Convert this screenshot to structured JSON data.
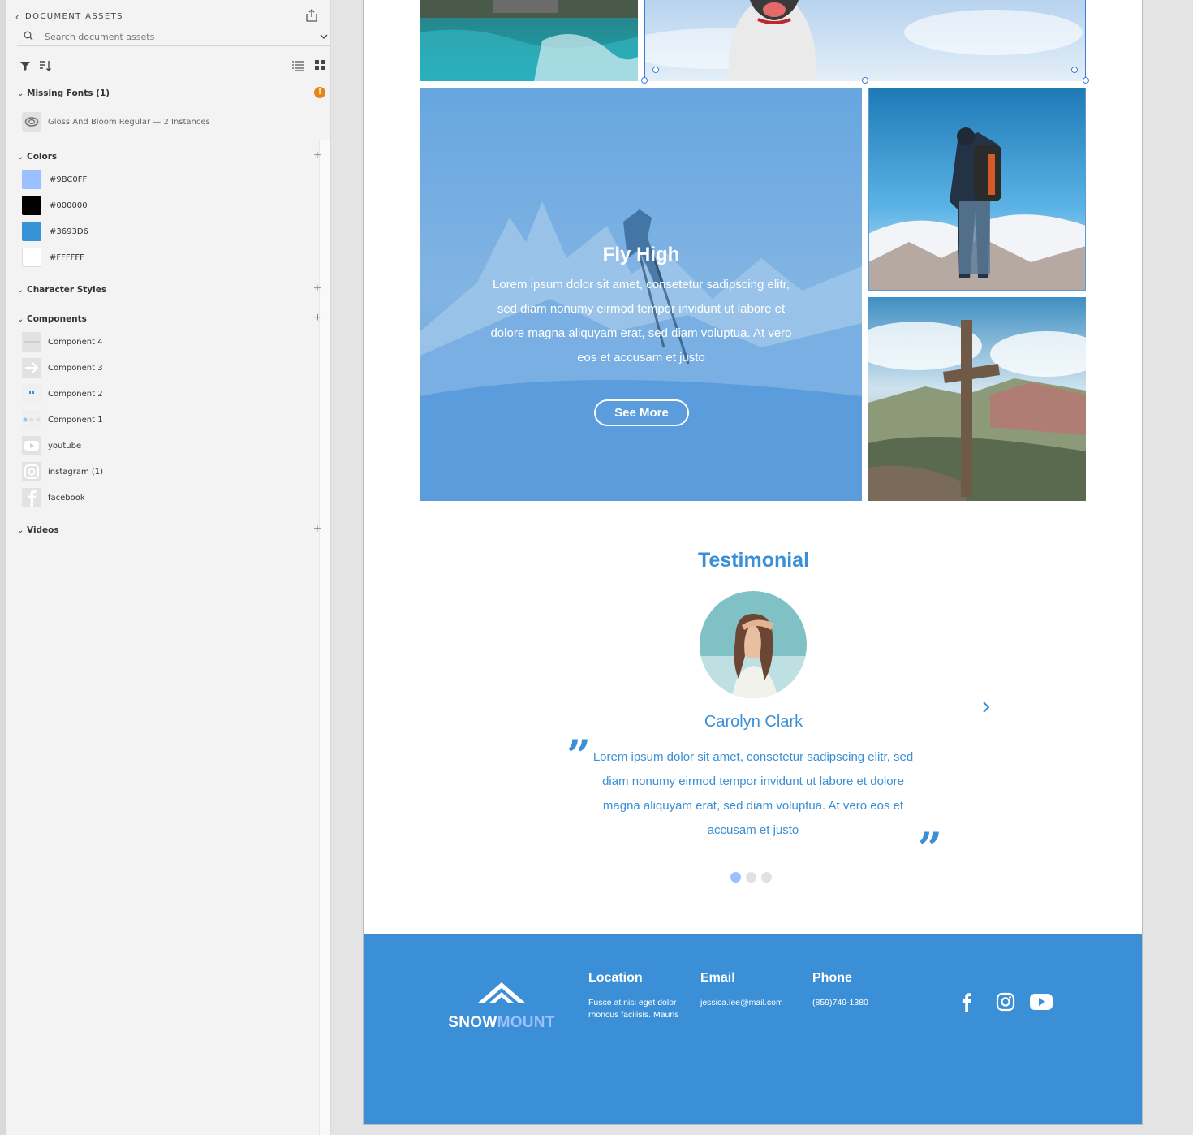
{
  "sidebar": {
    "title": "DOCUMENT ASSETS",
    "search_placeholder": "Search document assets",
    "missing_fonts": {
      "label": "Missing Fonts (1)",
      "items": [
        {
          "label": "Gloss And Bloom Regular — 2 Instances"
        }
      ]
    },
    "colors": {
      "label": "Colors",
      "items": [
        {
          "label": "#9BC0FF",
          "hex": "#9BC0FF"
        },
        {
          "label": "#000000",
          "hex": "#000000"
        },
        {
          "label": "#3693D6",
          "hex": "#3693D6"
        },
        {
          "label": "#FFFFFF",
          "hex": "#FFFFFF"
        }
      ]
    },
    "character_styles": {
      "label": "Character Styles"
    },
    "components": {
      "label": "Components",
      "items": [
        {
          "label": "Component 4"
        },
        {
          "label": "Component 3"
        },
        {
          "label": "Component 2"
        },
        {
          "label": "Component 1"
        },
        {
          "label": "youtube"
        },
        {
          "label": "instagram (1)"
        },
        {
          "label": "facebook"
        }
      ]
    },
    "videos": {
      "label": "Videos"
    }
  },
  "artboard": {
    "hero": {
      "title": "Fly High",
      "body": "Lorem ipsum dolor sit amet, consetetur sadipscing elitr, sed diam nonumy eirmod tempor invidunt ut labore et dolore magna aliquyam erat, sed diam voluptua. At vero eos et accusam et justo",
      "button": "See More"
    },
    "testimonial": {
      "title": "Testimonial",
      "name": "Carolyn Clark",
      "quote": "Lorem ipsum dolor sit amet, consetetur sadipscing elitr, sed diam nonumy eirmod tempor invidunt ut labore et dolore magna aliquyam erat, sed diam voluptua. At vero eos et accusam et justo",
      "open_quote": "”",
      "close_quote": "”"
    },
    "footer": {
      "brand_part1": "SNOW",
      "brand_part2": "MOUNT",
      "location": {
        "heading": "Location",
        "text": "Fusce at nisi eget dolor rhoncus facilisis. Mauris"
      },
      "email": {
        "heading": "Email",
        "text": "jessica.lee@mail.com"
      },
      "phone": {
        "heading": "Phone",
        "text": "(859)749-1380"
      }
    }
  },
  "colors": {
    "primary": "#3693D6",
    "accent": "#9BC0FF",
    "selection": "#3D7ED8",
    "warning": "#E68619"
  },
  "icons": [
    "chevron-left-icon",
    "share-icon",
    "search-icon",
    "chevron-down-icon",
    "filter-icon",
    "sort-icon",
    "list-view-icon",
    "grid-view-icon",
    "warning-icon",
    "plus-icon",
    "chevron-right-icon",
    "facebook-icon",
    "instagram-icon",
    "youtube-icon"
  ]
}
